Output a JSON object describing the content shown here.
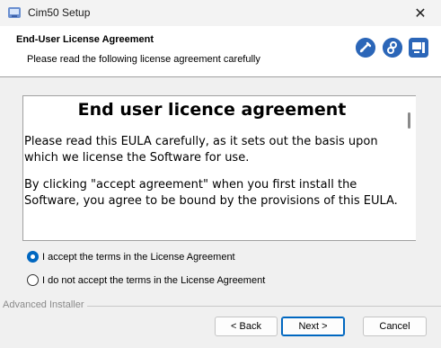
{
  "window": {
    "title": "Cim50 Setup",
    "close_glyph": "✕"
  },
  "header": {
    "title": "End-User License Agreement",
    "subtitle": "Please read the following license agreement carefully",
    "icons": [
      "tools-icon",
      "gear-icon",
      "computer-icon"
    ]
  },
  "eula": {
    "heading": "End user licence agreement",
    "paragraphs": [
      "Please read this EULA carefully, as it sets out the basis upon which we license the Software for use.",
      "By clicking \"accept agreement\" when you first install the Software, you agree to be bound by the provisions of this EULA."
    ]
  },
  "options": {
    "accept_label": "I accept the terms in the License Agreement",
    "decline_label": "I do not accept the terms in the License Agreement",
    "selected": "accept"
  },
  "footer": {
    "brand": "Advanced Installer",
    "back_label": "< Back",
    "next_label": "Next >",
    "cancel_label": "Cancel"
  },
  "colors": {
    "accent": "#0067c0",
    "header_icon": "#2b66b8"
  }
}
